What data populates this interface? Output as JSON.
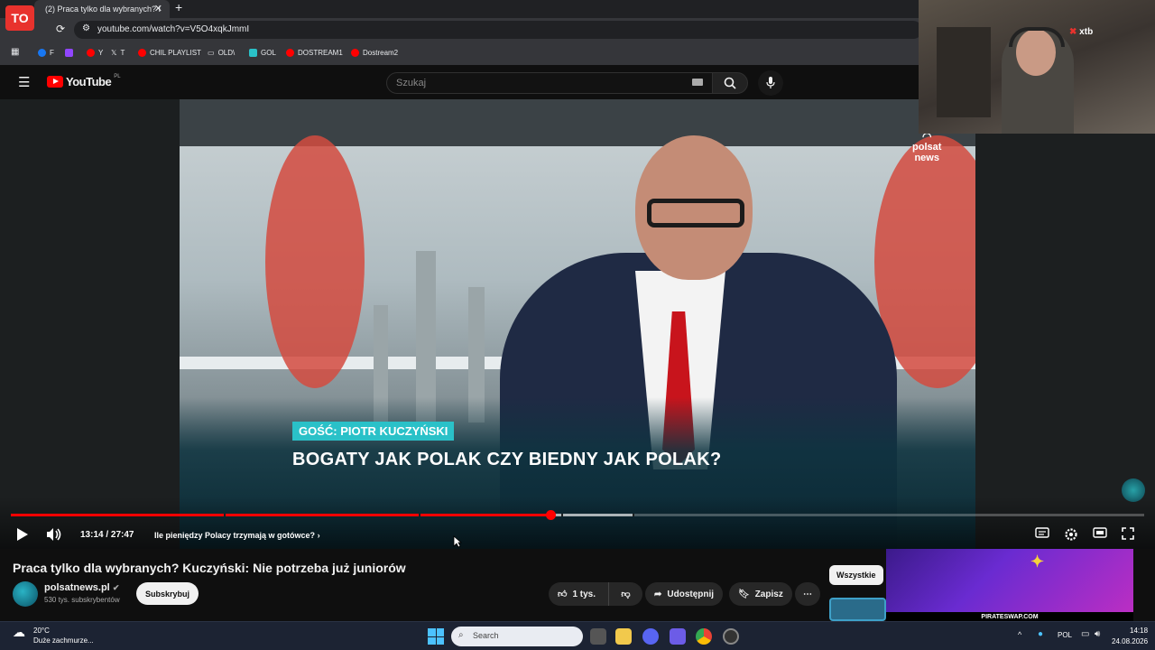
{
  "browser": {
    "tab_title": "(2) Praca tylko dla wybranych? I",
    "url": "youtube.com/watch?v=V5O4xqkJmmI",
    "bookmarks": [
      "F",
      "Y",
      "T",
      "CHIL PLAYLIST",
      "OLD\\",
      "GOL",
      "DOSTREAM1",
      "Dostream2"
    ]
  },
  "youtube": {
    "logo_text": "YouTube",
    "logo_region": "PL",
    "search_placeholder": "Szukaj"
  },
  "video": {
    "guest_label": "GOŚĆ: PIOTR KUCZYŃSKI",
    "headline": "BOGATY JAK POLAK CZY BIEDNY JAK POLAK?",
    "channel_logo": "polsat\nnews",
    "current_time": "13:14 / 27:47",
    "chapter": "Ile pieniędzy Polacy trzymają w gotówce?",
    "progress_played": 0.476,
    "progress_buffered": 0.55
  },
  "meta": {
    "title": "Praca tylko dla wybranych? Kuczyński: Nie potrzeba już juniorów",
    "channel_name": "polsatnews.pl",
    "subscribers": "530 tys. subskrybentów",
    "subscribe_label": "Subskrybuj",
    "likes": "1 tys.",
    "share_label": "Udostępnij",
    "save_label": "Zapisz",
    "chip_all": "Wszystkie"
  },
  "overlay": {
    "webcam_sponsor": "xtb",
    "ad_footer": "PIRATESWAP.COM"
  },
  "taskbar": {
    "temperature": "20°C",
    "weather_desc": "Duże zachmurze...",
    "search_placeholder": "Search",
    "language": "POL",
    "time": "14:18",
    "date": "24.08.2026"
  },
  "colors": {
    "yt_red": "#ff0000",
    "accent_cyan": "#2ac1c8",
    "tie_red": "#c8141c"
  }
}
